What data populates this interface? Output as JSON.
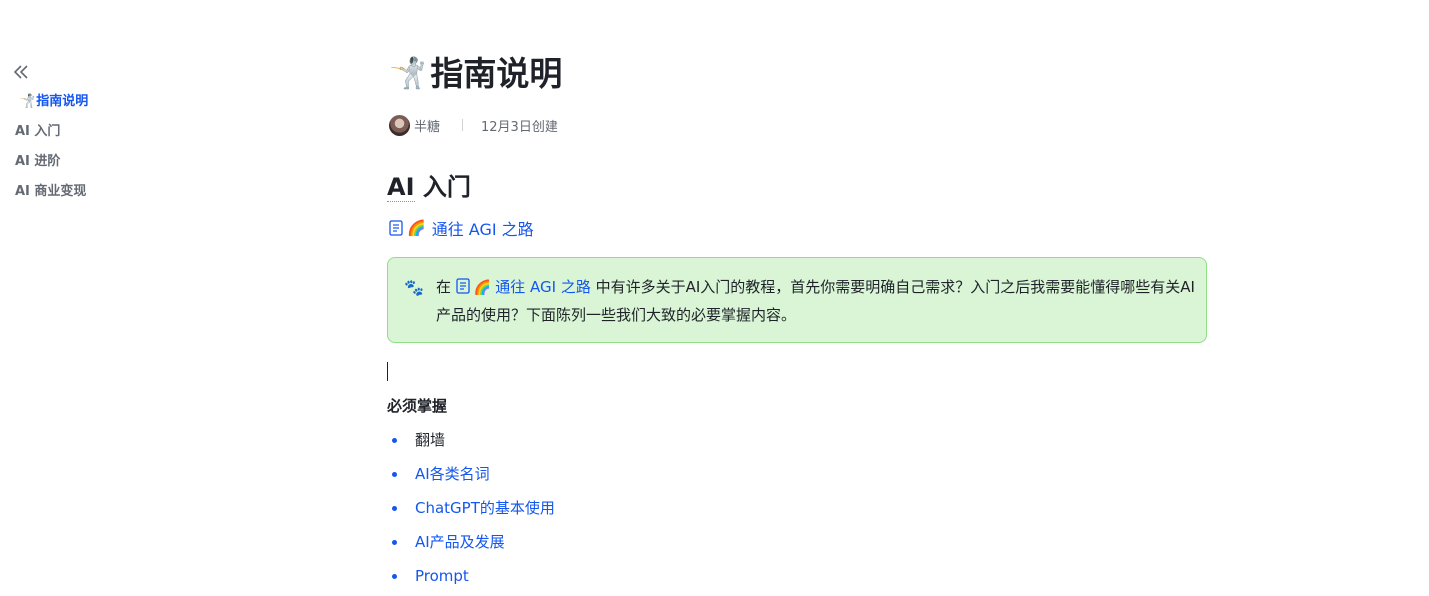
{
  "outline": {
    "collapse_icon": "double-chevron-left-icon",
    "items": [
      {
        "emoji": "🤺",
        "label": "指南说明",
        "active": true
      },
      {
        "label": "AI 入门"
      },
      {
        "label": "AI 进阶"
      },
      {
        "label": "AI 商业变现"
      }
    ]
  },
  "doc": {
    "title_emoji": "🤺",
    "title": "指南说明",
    "author": "半糖",
    "created": "12月3日创建",
    "section_heading_prefix": "AI",
    "section_heading_suffix": " 入门",
    "link": {
      "icon": "doc-icon",
      "emoji": "🌈",
      "text": "通往 AGI 之路"
    },
    "callout": {
      "icon": "paw-icon",
      "icon_glyph": "🐾",
      "text_before": "在",
      "link_emoji": "🌈",
      "link_text": "通往 AGI 之路",
      "text_after": " 中有许多关于AI入门的教程，首先你需要明确自己需求？入门之后我需要能懂得哪些有关AI产品的使用？下面陈列一些我们大致的必要掌握内容。",
      "bg_color": "#d9f5d6",
      "border_color": "#8ee085"
    },
    "subheading": "必须掌握",
    "bullets": [
      {
        "text": "翻墙",
        "link": false
      },
      {
        "text": "AI各类名词",
        "link": true
      },
      {
        "text": "ChatGPT的基本使用",
        "link": true
      },
      {
        "text": "AI产品及发展",
        "link": true
      },
      {
        "text": "Prompt",
        "link": true
      }
    ],
    "accent_color": "#1456f0"
  }
}
